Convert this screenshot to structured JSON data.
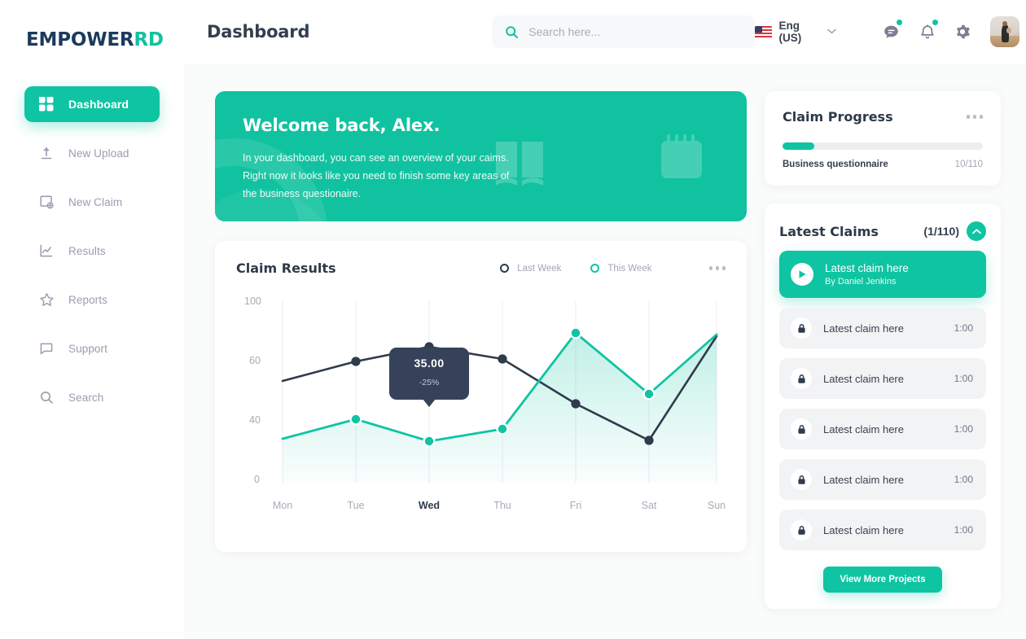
{
  "brand": {
    "main": "EMPOWER",
    "accent": "RD"
  },
  "sidebar": {
    "items": [
      {
        "label": "Dashboard",
        "icon": "grid-icon",
        "active": true
      },
      {
        "label": "New Upload",
        "icon": "upload-icon",
        "active": false
      },
      {
        "label": "New Claim",
        "icon": "new-claim-icon",
        "active": false
      },
      {
        "label": "Results",
        "icon": "chart-line-icon",
        "active": false
      },
      {
        "label": "Reports",
        "icon": "star-icon",
        "active": false
      },
      {
        "label": "Support",
        "icon": "chat-bubble-icon",
        "active": false
      },
      {
        "label": "Search",
        "icon": "search-icon",
        "active": false
      }
    ]
  },
  "header": {
    "title": "Dashboard",
    "search_placeholder": "Search here...",
    "search_value": "",
    "language": "Eng (US)",
    "flag": "us-flag-icon"
  },
  "welcome": {
    "heading": "Welcome back, Alex.",
    "body": "In your dashboard, you can see an overview of your caims. Right now it looks like you need to finish some key areas of the business questionaire."
  },
  "chart_card": {
    "title": "Claim Results",
    "legend": [
      {
        "label": "Last Week",
        "color": "#2f3b4c"
      },
      {
        "label": "This Week",
        "color": "#0fc4a2"
      }
    ],
    "menu": "more-options-icon"
  },
  "chart_data": {
    "type": "line",
    "title": "Claim Results",
    "xlabel": "",
    "ylabel": "",
    "x": [
      "Mon",
      "Tue",
      "Wed",
      "Thu",
      "Fri",
      "Sat",
      "Sun"
    ],
    "highlighted_x": "Wed",
    "yticks": [
      0,
      40,
      60,
      100
    ],
    "ylim": [
      0,
      100
    ],
    "grid": "vertical",
    "legend_position": "top-right",
    "series": [
      {
        "name": "Last Week",
        "color": "#2f3b4c",
        "values": [
          53,
          58,
          67,
          61,
          44,
          28,
          83
        ]
      },
      {
        "name": "This Week",
        "color": "#0fc4a2",
        "values": [
          35,
          48,
          35,
          43,
          85,
          50,
          84
        ]
      }
    ],
    "annotation": {
      "x": "Wed",
      "series": "This Week",
      "value": "35.00",
      "delta": "-25%"
    }
  },
  "progress_card": {
    "title": "Claim Progress",
    "menu": "more-options-icon",
    "label": "Business questionnaire",
    "count": "10/110",
    "percent": 16
  },
  "claims_card": {
    "title": "Latest Claims",
    "count": "(1/110)",
    "collapse_icon": "chevron-up-icon",
    "items": [
      {
        "title": "Latest claim here",
        "subtitle": "By Daniel Jenkins",
        "icon": "play-icon",
        "active": true
      },
      {
        "title": "Latest claim here",
        "time": "1:00",
        "icon": "lock-icon",
        "active": false
      },
      {
        "title": "Latest claim here",
        "time": "1:00",
        "icon": "lock-icon",
        "active": false
      },
      {
        "title": "Latest claim here",
        "time": "1:00",
        "icon": "lock-icon",
        "active": false
      },
      {
        "title": "Latest claim here",
        "time": "1:00",
        "icon": "lock-icon",
        "active": false
      },
      {
        "title": "Latest claim here",
        "time": "1:00",
        "icon": "lock-icon",
        "active": false
      }
    ],
    "view_more_label": "View More Projects"
  },
  "colors": {
    "accent": "#0fc4a2",
    "dark": "#2f3b4c",
    "bg": "#fafbfb"
  }
}
